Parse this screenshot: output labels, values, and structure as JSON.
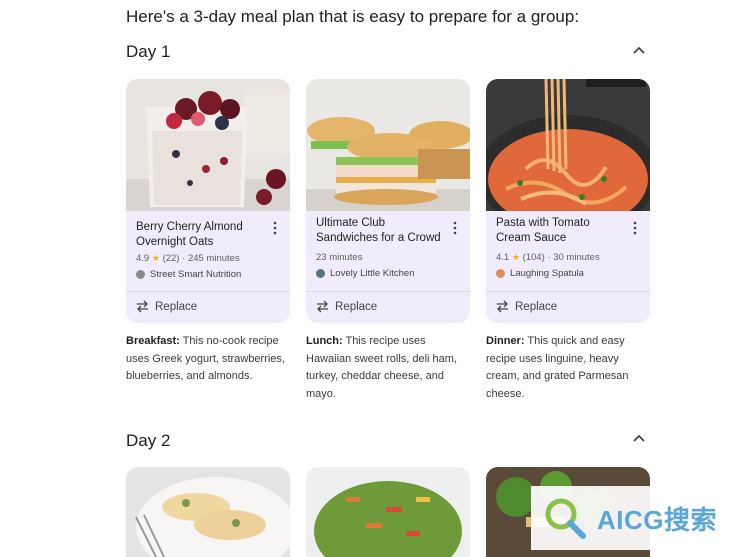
{
  "intro": "Here's a 3-day meal plan that is easy to prepare for a group:",
  "days": [
    {
      "title": "Day 1",
      "cards": [
        {
          "title": "Berry Cherry Almond Overnight Oats",
          "rating": "4.9",
          "reviews": "(22)",
          "time": "245 minutes",
          "source": "Street Smart Nutrition",
          "replace": "Replace",
          "meal": "Breakfast:",
          "desc": " This no-cook recipe uses Greek yogurt, strawberries, blueberries, and almonds."
        },
        {
          "title": "Ultimate Club Sandwiches for a Crowd",
          "time": "23 minutes",
          "source": "Lovely Little Kitchen",
          "replace": "Replace",
          "meal": "Lunch:",
          "desc": " This recipe uses Hawaiian sweet rolls, deli ham, turkey, cheddar cheese, and mayo."
        },
        {
          "title": "Pasta with Tomato Cream Sauce",
          "rating": "4.1",
          "reviews": "(104)",
          "time": "30 minutes",
          "source": "Laughing Spatula",
          "replace": "Replace",
          "meal": "Dinner:",
          "desc": " This quick and easy recipe uses linguine, heavy cream, and grated Parmesan cheese."
        }
      ]
    },
    {
      "title": "Day 2"
    }
  ],
  "watermark": "AICG搜索",
  "colors": {
    "card_bg": "#f1ecfb",
    "star": "#f4b400",
    "watermark": "#5aa6d8"
  }
}
